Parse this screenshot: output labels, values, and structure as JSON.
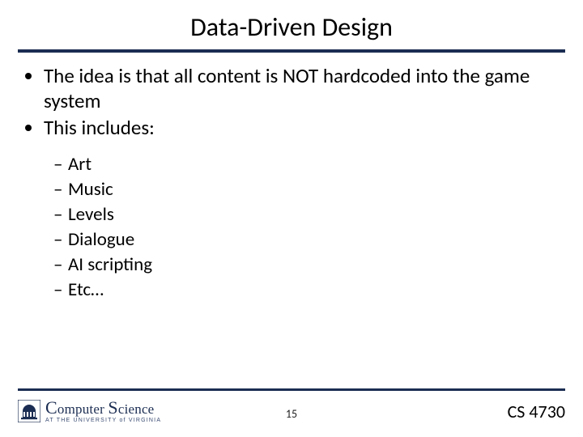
{
  "title": "Data-Driven Design",
  "bullets": [
    "The idea is that all content is NOT hardcoded into the game system",
    "This includes:"
  ],
  "subbullets": [
    "Art",
    "Music",
    "Levels",
    "Dialogue",
    "AI scripting",
    "Etc…"
  ],
  "footer": {
    "logo_primary": "Computer Science",
    "logo_secondary": "AT THE UNIVERSITY of VIRGINIA",
    "page_number": "15",
    "course_code": "CS 4730"
  }
}
